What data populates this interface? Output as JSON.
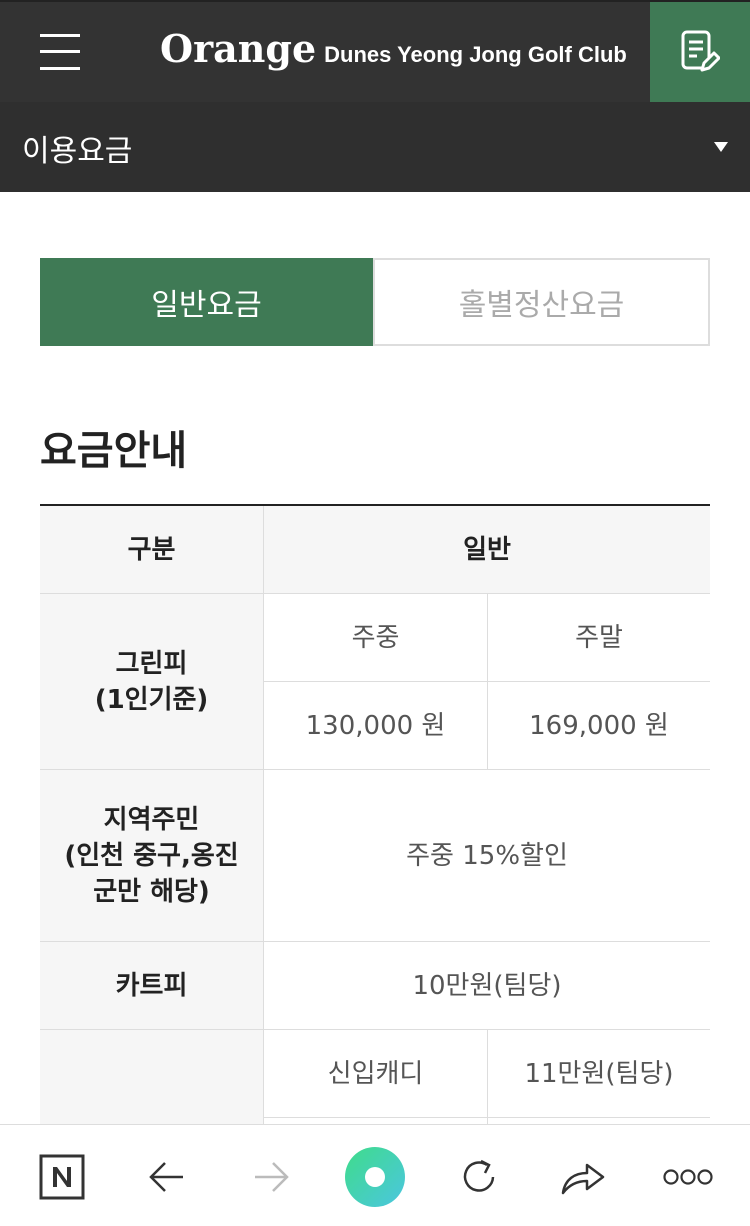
{
  "header": {
    "logo_main": "Orange",
    "logo_sub": "Dunes Yeong Jong Golf Club",
    "menu_icon": "hamburger-menu-icon",
    "notice_icon": "document-edit-icon",
    "accent_color": "#3f7a55"
  },
  "subnav": {
    "label": "이용요금",
    "dropdown_icon": "caret-down-icon"
  },
  "tabs": [
    {
      "label": "일반요금",
      "active": true
    },
    {
      "label": "홀별정산요금",
      "active": false
    }
  ],
  "section_title": "요금안내",
  "table": {
    "header": {
      "category": "구분",
      "general": "일반"
    },
    "green_fee": {
      "label_line1": "그린피",
      "label_line2": "(1인기준)",
      "weekday": "주중",
      "weekend": "주말",
      "weekday_price": "130,000 원",
      "weekend_price": "169,000 원"
    },
    "resident": {
      "label_line1": "지역주민",
      "label_line2": "(인천 중구,옹진",
      "label_line3": "군만 해당)",
      "value": "주중 15%할인"
    },
    "cart": {
      "label": "카트피",
      "value": "10만원(팀당)"
    },
    "caddie": {
      "type": "신입캐디",
      "value": "11만원(팀당)"
    }
  },
  "bottom_bar": {
    "icons": [
      "naver-home-icon",
      "back-arrow-icon",
      "forward-arrow-icon",
      "green-dot-icon",
      "refresh-icon",
      "share-icon",
      "more-icon"
    ]
  }
}
